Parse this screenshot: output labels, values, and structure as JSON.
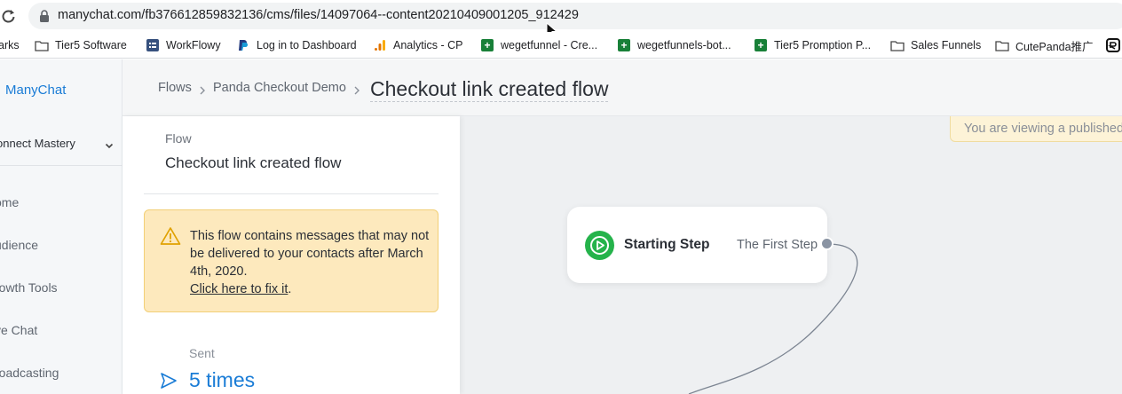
{
  "browser": {
    "url": "manychat.com/fb376612859832136/cms/files/14097064--content20210409001205_912429",
    "bookmarks": [
      {
        "label": "arks",
        "icon": "bookmarks-icon"
      },
      {
        "label": "Tier5 Software",
        "icon": "folder-icon"
      },
      {
        "label": "WorkFlowy",
        "icon": "workflowy-icon"
      },
      {
        "label": "Log in to Dashboard",
        "icon": "paypal-icon"
      },
      {
        "label": "Analytics - CP",
        "icon": "analytics-icon"
      },
      {
        "label": "wegetfunnel - Cre...",
        "icon": "google-sheets-icon"
      },
      {
        "label": "wegetfunnels-bot...",
        "icon": "google-sheets-icon"
      },
      {
        "label": "Tier5 Promption P...",
        "icon": "google-sheets-icon"
      },
      {
        "label": "Sales Funnels",
        "icon": "folder-icon"
      },
      {
        "label": "CutePanda推广",
        "icon": "folder-icon"
      }
    ]
  },
  "sidebar": {
    "brand": "ManyChat",
    "workspace": "onnect Mastery",
    "items": [
      {
        "label": "ome"
      },
      {
        "label": "udience"
      },
      {
        "label": "rowth Tools"
      },
      {
        "label": "ve Chat"
      },
      {
        "label": "roadcasting"
      }
    ]
  },
  "header": {
    "breadcrumb": [
      "Flows",
      "Panda Checkout Demo"
    ],
    "title": "Checkout link created flow"
  },
  "panel": {
    "flow_label": "Flow",
    "flow_name": "Checkout link created flow",
    "warning": {
      "text": "This flow contains messages that may not be delivered to your contacts after March 4th, 2020.",
      "link": "Click here to fix it",
      "suffix": "."
    },
    "sent_label": "Sent",
    "sent_value": "5 times"
  },
  "canvas": {
    "notice": "You are viewing a published",
    "node": {
      "title": "Starting Step",
      "next_step": "The First Step"
    }
  },
  "colors": {
    "accent": "#1a7cd6",
    "start_green": "#25b34b",
    "warning_bg": "#fde9bd",
    "warning_border": "#f2cf76"
  }
}
